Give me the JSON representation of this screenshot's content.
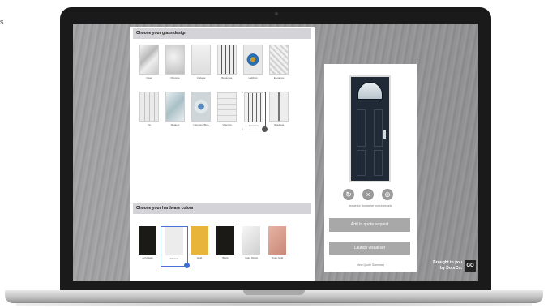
{
  "stray_char": "s",
  "glass_section": {
    "title": "Choose your glass design",
    "options": [
      {
        "label": "Clear"
      },
      {
        "label": "Obscure"
      },
      {
        "label": "Cabana"
      },
      {
        "label": "Bookcase"
      },
      {
        "label": "Halifrost"
      },
      {
        "label": "Elegance"
      },
      {
        "label": "Iris"
      },
      {
        "label": "Medeno"
      },
      {
        "label": "Harmony Blue"
      },
      {
        "label": "Valencia"
      },
      {
        "label": "Lucaena"
      },
      {
        "label": "Giordana"
      }
    ],
    "selected_index": 10
  },
  "hardware_section": {
    "title": "Choose your hardware colour",
    "options": [
      {
        "label": "Anti Black",
        "color": "#1c1a17"
      },
      {
        "label": "Chrome",
        "color": "#ececec"
      },
      {
        "label": "Gold",
        "color": "#e8b53a"
      },
      {
        "label": "Black",
        "color": "#1b1a17"
      },
      {
        "label": "Satin Nickel",
        "color": "#e4e4e4"
      },
      {
        "label": "Rose Gold",
        "color": "#d9a08e"
      }
    ],
    "selected_index": 1
  },
  "preview": {
    "disclaimer": "Image for illustrative purposes only",
    "add_quote": "Add to quote request",
    "launch": "Launch visualiser",
    "view_quote": "View Quote Summary"
  },
  "brand": {
    "line1": "Brought to you",
    "line2": "by DoorCo.",
    "logo": "GO"
  }
}
